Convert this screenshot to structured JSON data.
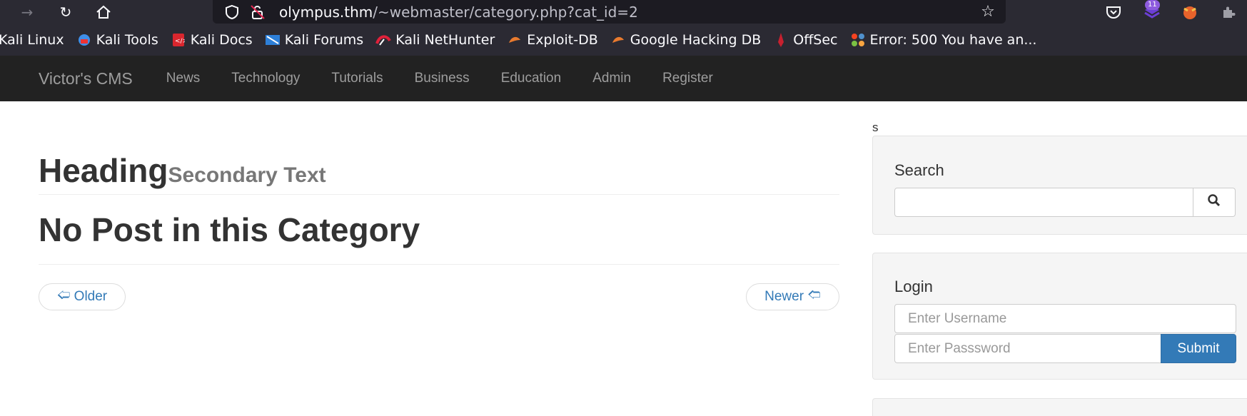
{
  "browser": {
    "url_host": "olympus.thm",
    "url_path": "/~webmaster/category.php?cat_id=2",
    "extension_badge": "11"
  },
  "bookmarks": [
    {
      "label": "Kali Linux",
      "icon": "kali-icon"
    },
    {
      "label": "Kali Tools",
      "icon": "kali-tools-icon"
    },
    {
      "label": "Kali Docs",
      "icon": "kali-docs-icon"
    },
    {
      "label": "Kali Forums",
      "icon": "kali-forums-icon"
    },
    {
      "label": "Kali NetHunter",
      "icon": "nethunter-icon"
    },
    {
      "label": "Exploit-DB",
      "icon": "exploit-db-icon"
    },
    {
      "label": "Google Hacking DB",
      "icon": "ghdb-icon"
    },
    {
      "label": "OffSec",
      "icon": "offsec-icon"
    },
    {
      "label": "Error: 500 You have an...",
      "icon": "joomla-icon"
    }
  ],
  "navbar": {
    "brand": "Victor's CMS",
    "links": [
      "News",
      "Technology",
      "Tutorials",
      "Business",
      "Education",
      "Admin",
      "Register"
    ]
  },
  "main": {
    "stray_char": "s",
    "heading": "Heading",
    "heading_secondary": "Secondary Text",
    "no_post": "No Post in this Category",
    "older_label": "Older",
    "newer_label": "Newer"
  },
  "sidebar": {
    "search_title": "Search",
    "login_title": "Login",
    "username_placeholder": "Enter Username",
    "password_placeholder": "Enter Passsword",
    "submit_label": "Submit"
  },
  "colors": {
    "navbar_bg": "#222222",
    "link": "#337ab7",
    "primary_button": "#337ab7"
  }
}
